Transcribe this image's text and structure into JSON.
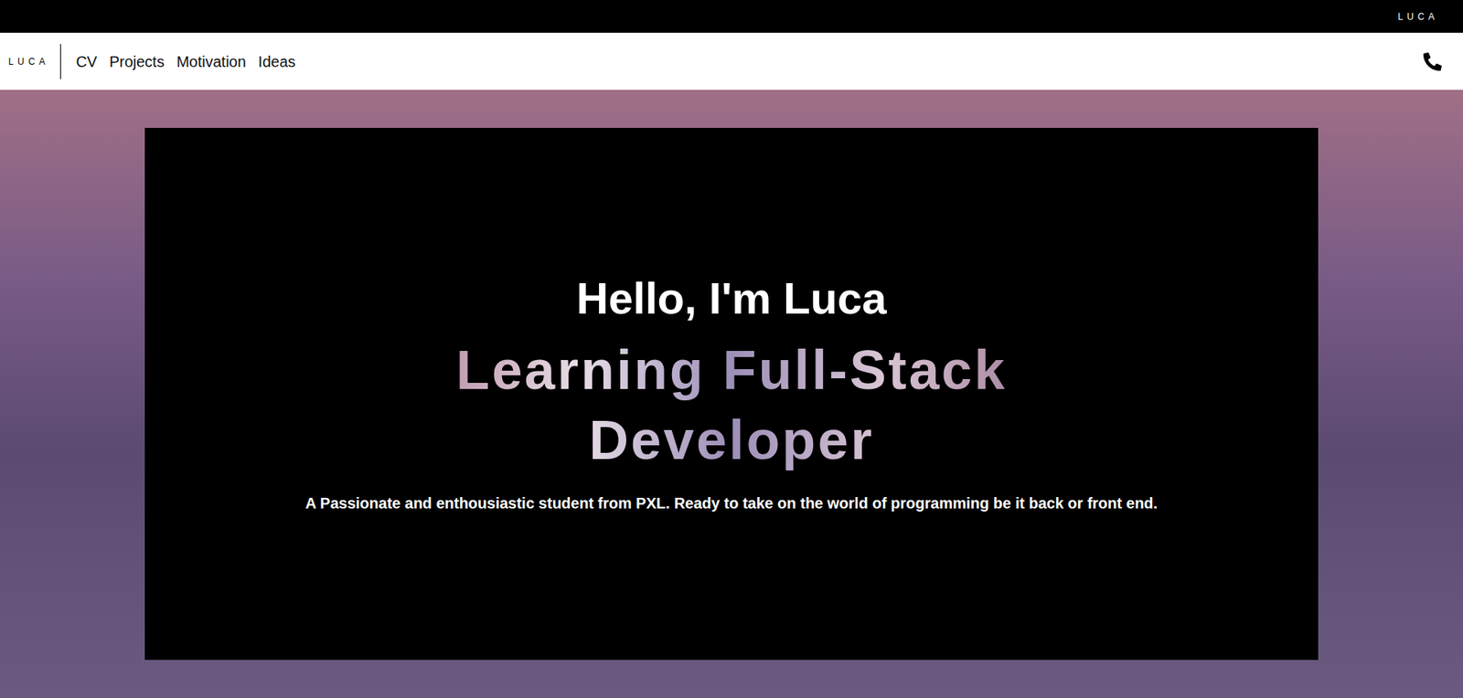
{
  "top_bar": {
    "logo": "LUCA"
  },
  "nav": {
    "logo": "LUCA",
    "links": [
      {
        "label": "CV"
      },
      {
        "label": "Projects"
      },
      {
        "label": "Motivation"
      },
      {
        "label": "Ideas"
      }
    ]
  },
  "hero": {
    "greeting": "Hello, I'm Luca",
    "title": "Learning Full-Stack Developer",
    "description": "A Passionate and enthousiastic student from PXL. Ready to take on the world of programming be it back or front end."
  }
}
